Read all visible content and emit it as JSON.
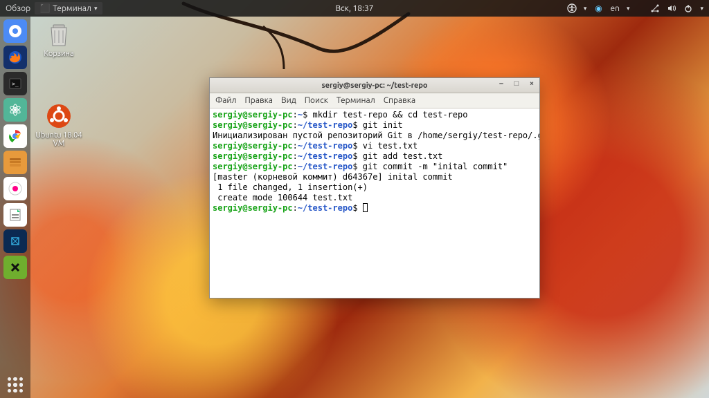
{
  "topbar": {
    "overview": "Обзор",
    "active_app": "Терминал",
    "clock": "Вск, 18:37",
    "lang": "en",
    "tray": {
      "a11y": "accessibility",
      "network": "wired",
      "sound": "volume",
      "power": "power"
    }
  },
  "desktop": {
    "trash": "Корзина",
    "ubuntu_vm": "Ubuntu 18.04 VM"
  },
  "dock": {
    "apps": [
      {
        "name": "chromium",
        "bg": "#4c8bf5",
        "glyph": "◯"
      },
      {
        "name": "firefox",
        "bg": "#1b5fbf",
        "glyph": "🦊"
      },
      {
        "name": "terminal",
        "bg": "#2b2b2b",
        "glyph": ">_"
      },
      {
        "name": "atom",
        "bg": "#5fb89a",
        "glyph": "⚛"
      },
      {
        "name": "chrome",
        "bg": "#ffffff",
        "glyph": "◉"
      },
      {
        "name": "files",
        "bg": "#e79a3c",
        "glyph": "🗂"
      },
      {
        "name": "software",
        "bg": "#ffffff",
        "glyph": "⭳"
      },
      {
        "name": "libreoffice",
        "bg": "#ffffff",
        "glyph": "≣"
      },
      {
        "name": "virtualbox",
        "bg": "#1a3c6e",
        "glyph": "▣"
      },
      {
        "name": "x-diagnose",
        "bg": "#7bc043",
        "glyph": "✶"
      }
    ]
  },
  "window": {
    "title": "sergiy@sergiy-pc: ~/test-repo",
    "menu": [
      "Файл",
      "Правка",
      "Вид",
      "Поиск",
      "Терминал",
      "Справка"
    ],
    "controls": {
      "min": "–",
      "max": "□",
      "close": "×"
    }
  },
  "term": {
    "user": "sergiy@sergiy-pc",
    "colon": ":",
    "dollar": "$",
    "home": "~",
    "repo": "~/test-repo",
    "l1_cmd": " mkdir test-repo && cd test-repo",
    "l2_cmd": " git init",
    "l3": "Инициализирован пустой репозиторий Git в /home/sergiy/test-repo/.git/",
    "l4_cmd": " vi test.txt",
    "l5_cmd": " git add test.txt",
    "l6_cmd": " git commit -m \"inital commit\"",
    "l7": "[master (корневой коммит) d64367e] inital commit",
    "l8": " 1 file changed, 1 insertion(+)",
    "l9": " create mode 100644 test.txt"
  }
}
